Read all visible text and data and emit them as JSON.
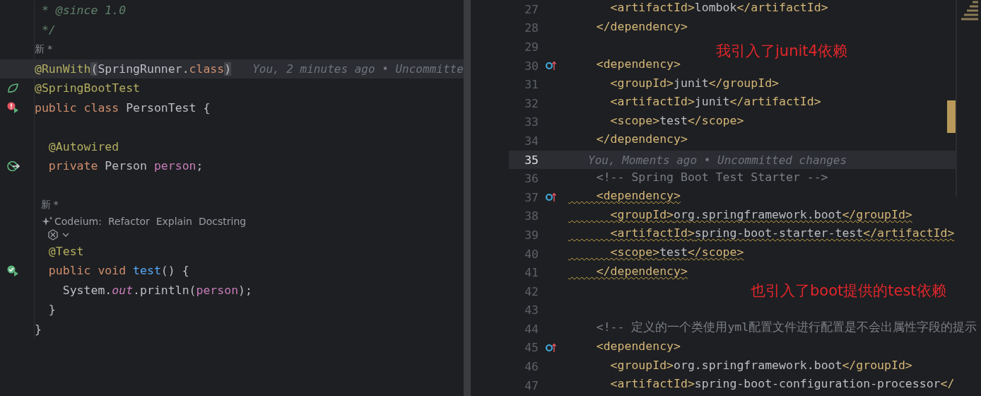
{
  "left_editor": {
    "lines": [
      {
        "kind": "code",
        "current": false,
        "tokens": [
          {
            "kind": "doc",
            "text": " * @since 1.0"
          }
        ]
      },
      {
        "kind": "code",
        "current": false,
        "tokens": [
          {
            "kind": "doc",
            "text": " */"
          }
        ]
      },
      {
        "kind": "hint",
        "text": "新 *"
      },
      {
        "kind": "code",
        "current": true,
        "tokens": [
          {
            "kind": "ann",
            "text": "@RunWith"
          },
          {
            "kind": "brace",
            "text": "("
          },
          {
            "kind": "plain",
            "text": "SpringRunner."
          },
          {
            "kind": "kw",
            "text": "class"
          },
          {
            "kind": "brace",
            "text": ")"
          }
        ],
        "blame": "You, 2 minutes ago • Uncommitte"
      },
      {
        "kind": "code",
        "current": false,
        "gutter_icon": {
          "kind": "leaf"
        },
        "tokens": [
          {
            "kind": "ann",
            "text": "@SpringBootTest"
          }
        ]
      },
      {
        "kind": "code",
        "current": false,
        "gutter_icon": {
          "kind": "run-error"
        },
        "tokens": [
          {
            "kind": "kw",
            "text": "public class "
          },
          {
            "kind": "plain",
            "text": "PersonTest {"
          }
        ]
      },
      {
        "kind": "code",
        "current": false
      },
      {
        "kind": "code",
        "current": false,
        "tokens": [
          {
            "kind": "ann",
            "text": "  @Autowired"
          }
        ]
      },
      {
        "kind": "code",
        "current": false,
        "gutter_icon": {
          "kind": "bean"
        },
        "tokens": [
          {
            "kind": "kw",
            "text": "  private "
          },
          {
            "kind": "plain",
            "text": "Person "
          },
          {
            "kind": "field",
            "text": "person"
          },
          {
            "kind": "plain",
            "text": ";"
          }
        ]
      },
      {
        "kind": "code",
        "current": false
      },
      {
        "kind": "hint",
        "text": "  新 *"
      },
      {
        "kind": "lens",
        "items": [
          "Codeium:",
          "Refactor",
          "Explain",
          "Docstring"
        ]
      },
      {
        "kind": "menu"
      },
      {
        "kind": "code",
        "current": false,
        "tokens": [
          {
            "kind": "ann",
            "text": "  @Test"
          }
        ]
      },
      {
        "kind": "code",
        "current": false,
        "gutter_icon": {
          "kind": "run-pass"
        },
        "tokens": [
          {
            "kind": "kw",
            "text": "  public void "
          },
          {
            "kind": "method",
            "text": "test"
          },
          {
            "kind": "plain",
            "text": "() {"
          }
        ]
      },
      {
        "kind": "code",
        "current": false,
        "tokens": [
          {
            "kind": "plain",
            "text": "    System."
          },
          {
            "kind": "static",
            "text": "out"
          },
          {
            "kind": "plain",
            "text": ".println("
          },
          {
            "kind": "field",
            "text": "person"
          },
          {
            "kind": "plain",
            "text": ");"
          }
        ]
      },
      {
        "kind": "code",
        "current": false,
        "tokens": [
          {
            "kind": "plain",
            "text": "  }"
          }
        ]
      },
      {
        "kind": "code",
        "current": false,
        "tokens": [
          {
            "kind": "plain",
            "text": "}"
          }
        ]
      }
    ]
  },
  "right_editor": {
    "lines": [
      {
        "number": "27",
        "current": false,
        "warning": false,
        "tokens": [
          {
            "kind": "tag",
            "text": "      <artifactId>"
          },
          {
            "kind": "plain",
            "text": "lombok"
          },
          {
            "kind": "tag",
            "text": "</artifactId>"
          }
        ]
      },
      {
        "number": "28",
        "current": false,
        "warning": false,
        "tokens": [
          {
            "kind": "tag",
            "text": "    </dependency>"
          }
        ]
      },
      {
        "number": "29",
        "current": false
      },
      {
        "number": "30",
        "current": false,
        "warning": false,
        "gutter_icon": {
          "kind": "maven"
        },
        "tokens": [
          {
            "kind": "tag",
            "text": "    <dependency>"
          }
        ]
      },
      {
        "number": "31",
        "current": false,
        "warning": false,
        "tokens": [
          {
            "kind": "tag",
            "text": "      <groupId>"
          },
          {
            "kind": "plain",
            "text": "junit"
          },
          {
            "kind": "tag",
            "text": "</groupId>"
          }
        ]
      },
      {
        "number": "32",
        "current": false,
        "warning": false,
        "tokens": [
          {
            "kind": "tag",
            "text": "      <artifactId>"
          },
          {
            "kind": "plain",
            "text": "junit"
          },
          {
            "kind": "tag",
            "text": "</artifactId>"
          }
        ]
      },
      {
        "number": "33",
        "current": false,
        "warning": false,
        "tokens": [
          {
            "kind": "tag",
            "text": "      <scope>"
          },
          {
            "kind": "plain",
            "text": "test"
          },
          {
            "kind": "tag",
            "text": "</scope>"
          }
        ]
      },
      {
        "number": "34",
        "current": false,
        "warning": false,
        "tokens": [
          {
            "kind": "tag",
            "text": "    </dependency>"
          }
        ]
      },
      {
        "number": "35",
        "current": true,
        "blame": "You, Moments ago • Uncommitted changes"
      },
      {
        "number": "36",
        "current": false,
        "warning": false,
        "tokens": [
          {
            "kind": "comment",
            "text": "    <!-- Spring Boot Test Starter -->"
          }
        ]
      },
      {
        "number": "37",
        "current": false,
        "warning": true,
        "gutter_icon": {
          "kind": "maven"
        },
        "tokens": [
          {
            "kind": "tag",
            "text": "    <dependency>"
          }
        ]
      },
      {
        "number": "38",
        "current": false,
        "warning": true,
        "tokens": [
          {
            "kind": "tag",
            "text": "      <groupId>"
          },
          {
            "kind": "plain",
            "text": "org.springframework.boot"
          },
          {
            "kind": "tag",
            "text": "</groupId>"
          }
        ]
      },
      {
        "number": "39",
        "current": false,
        "warning": true,
        "tokens": [
          {
            "kind": "tag",
            "text": "      <artifactId>"
          },
          {
            "kind": "plain",
            "text": "spring-boot-starter-test"
          },
          {
            "kind": "tag",
            "text": "</artifactId>"
          }
        ]
      },
      {
        "number": "40",
        "current": false,
        "warning": true,
        "tokens": [
          {
            "kind": "tag",
            "text": "      <scope>"
          },
          {
            "kind": "plain",
            "text": "test"
          },
          {
            "kind": "tag",
            "text": "</scope>"
          }
        ]
      },
      {
        "number": "41",
        "current": false,
        "warning": true,
        "tokens": [
          {
            "kind": "tag",
            "text": "    </dependency>"
          }
        ]
      },
      {
        "number": "42",
        "current": false
      },
      {
        "number": "43",
        "current": false
      },
      {
        "number": "44",
        "current": false,
        "warning": false,
        "tokens": [
          {
            "kind": "comment",
            "text": "    <!-- 定义的一个类使用yml配置文件进行配置是不会出属性字段的提示"
          }
        ]
      },
      {
        "number": "45",
        "current": false,
        "warning": false,
        "gutter_icon": {
          "kind": "maven"
        },
        "tokens": [
          {
            "kind": "tag",
            "text": "    <dependency>"
          }
        ]
      },
      {
        "number": "46",
        "current": false,
        "warning": false,
        "tokens": [
          {
            "kind": "tag",
            "text": "      <groupId>"
          },
          {
            "kind": "plain",
            "text": "org.springframework.boot"
          },
          {
            "kind": "tag",
            "text": "</groupId>"
          }
        ]
      },
      {
        "number": "47",
        "current": false,
        "warning": false,
        "tokens": [
          {
            "kind": "tag",
            "text": "      <artifactId>"
          },
          {
            "kind": "plain",
            "text": "spring-boot-configuration-processor"
          },
          {
            "kind": "tag",
            "text": "</"
          }
        ]
      }
    ],
    "notes": [
      "我引入了junit4依赖",
      "也引入了boot提供的test依赖"
    ]
  }
}
